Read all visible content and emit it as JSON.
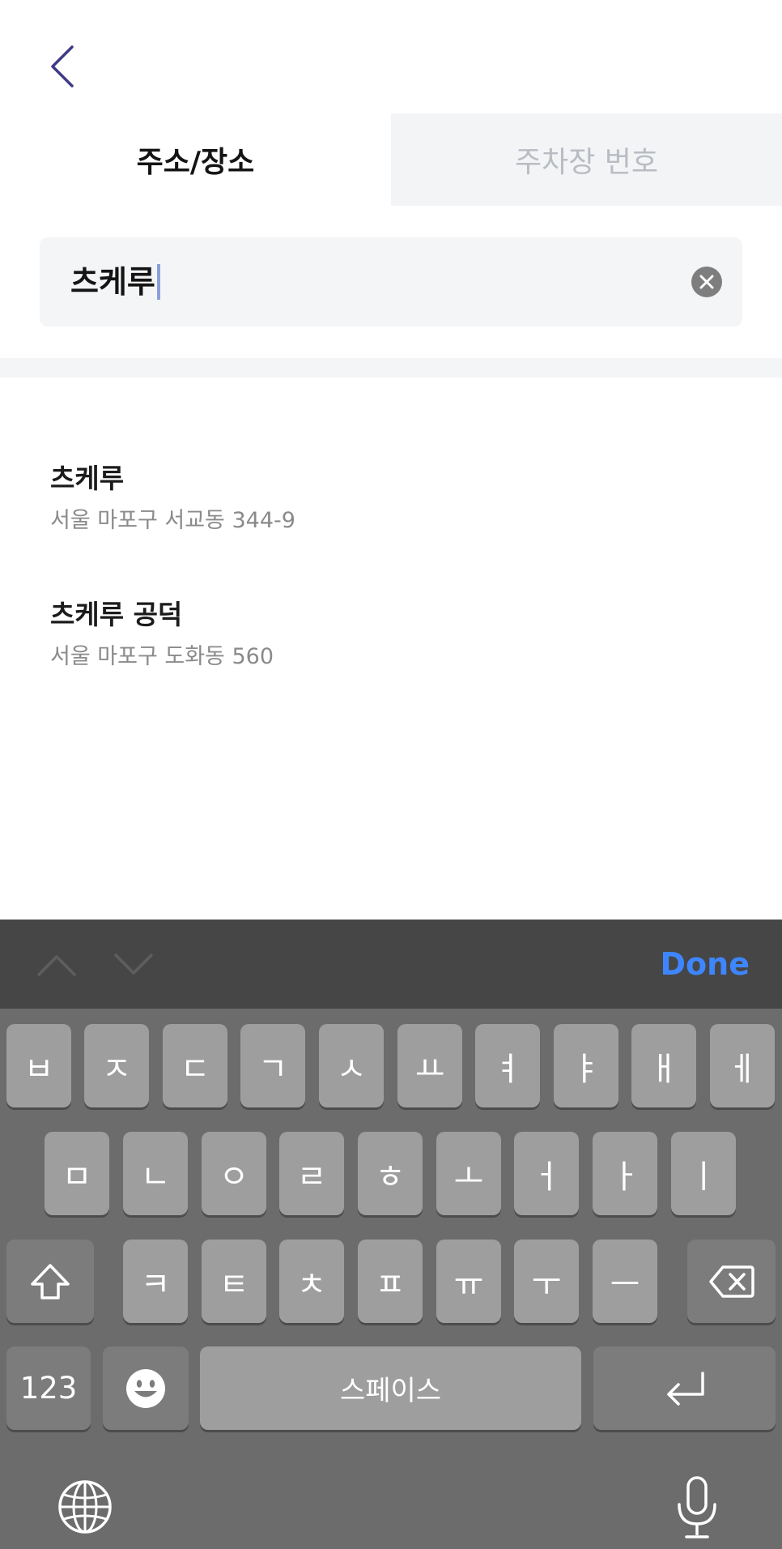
{
  "header": {
    "back_icon": "chevron-left-icon",
    "tabs": [
      {
        "label": "주소/장소",
        "active": true
      },
      {
        "label": "주차장 번호",
        "active": false
      }
    ]
  },
  "search": {
    "value": "츠케루",
    "clear_icon": "clear-icon"
  },
  "results": [
    {
      "name": "츠케루",
      "address": "서울 마포구 서교동 344-9"
    },
    {
      "name": "츠케루 공덕",
      "address": "서울 마포구 도화동 560"
    }
  ],
  "keyboard": {
    "accessory": {
      "prev_icon": "chevron-up-icon",
      "next_icon": "chevron-down-icon",
      "done_label": "Done"
    },
    "row1": [
      "ㅂ",
      "ㅈ",
      "ㄷ",
      "ㄱ",
      "ㅅ",
      "ㅛ",
      "ㅕ",
      "ㅑ",
      "ㅐ",
      "ㅔ"
    ],
    "row2": [
      "ㅁ",
      "ㄴ",
      "ㅇ",
      "ㄹ",
      "ㅎ",
      "ㅗ",
      "ㅓ",
      "ㅏ",
      "ㅣ"
    ],
    "row3": [
      "ㅋ",
      "ㅌ",
      "ㅊ",
      "ㅍ",
      "ㅠ",
      "ㅜ",
      "ㅡ"
    ],
    "numbers_label": "123",
    "space_label": "스페이스",
    "icons": {
      "shift": "shift-icon",
      "delete": "backspace-icon",
      "emoji": "emoji-icon",
      "return": "return-icon",
      "globe": "globe-icon",
      "mic": "microphone-icon"
    },
    "colors": {
      "accent": "#3e86ff",
      "key": "#9e9e9e",
      "key_dark": "#7c7c7c",
      "background": "#6c6c6c"
    }
  }
}
